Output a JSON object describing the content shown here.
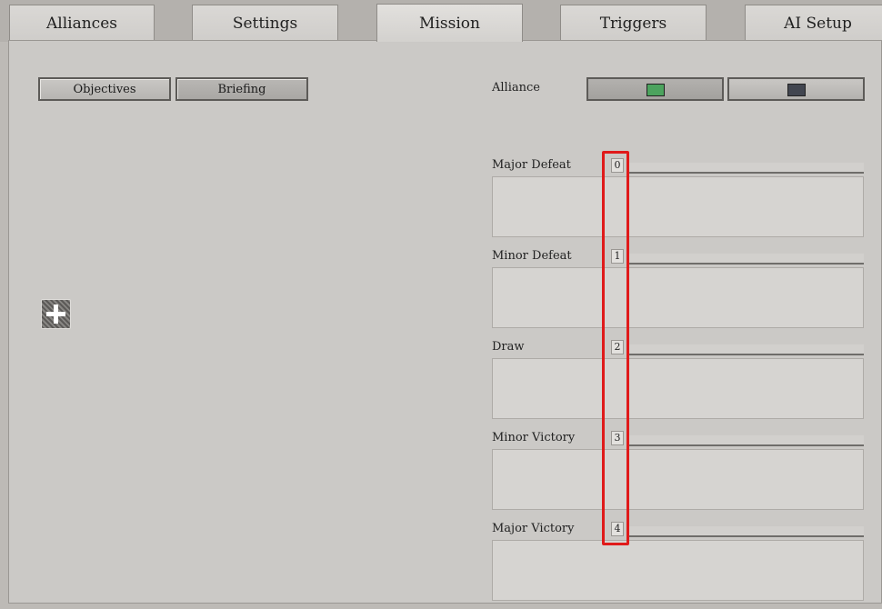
{
  "tabs": [
    {
      "label": "Alliances",
      "active": false
    },
    {
      "label": "Settings",
      "active": false
    },
    {
      "label": "Mission",
      "active": true
    },
    {
      "label": "Triggers",
      "active": false
    },
    {
      "label": "AI Setup",
      "active": false
    }
  ],
  "subtabs": {
    "objectives": "Objectives",
    "briefing": "Briefing",
    "selected": "Briefing"
  },
  "alliance": {
    "label": "Alliance",
    "options": [
      {
        "color": "#4ca35e",
        "selected": true
      },
      {
        "color": "#424650",
        "selected": false
      }
    ]
  },
  "add_icon": "plus-icon",
  "outcomes": [
    {
      "label": "Major Defeat",
      "value": "0"
    },
    {
      "label": "Minor Defeat",
      "value": "1"
    },
    {
      "label": "Draw",
      "value": "2"
    },
    {
      "label": "Minor Victory",
      "value": "3"
    },
    {
      "label": "Major Victory",
      "value": "4"
    }
  ],
  "highlight_color": "#e01a1a"
}
